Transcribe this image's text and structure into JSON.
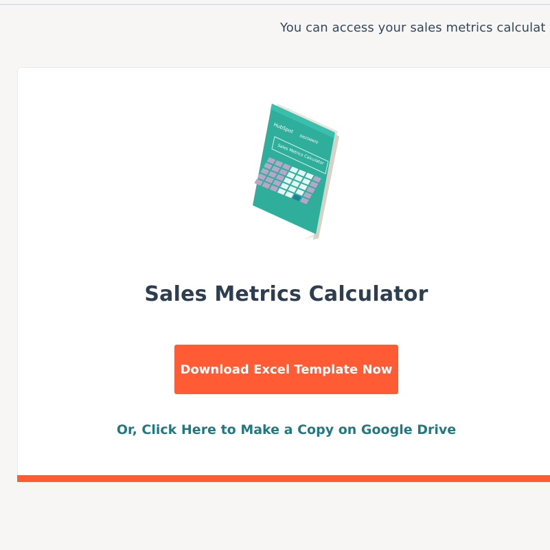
{
  "intro_text": "You can access your sales metrics calculat",
  "card": {
    "title": "Sales Metrics Calculator",
    "download_button_label": "Download Excel Template Now",
    "google_drive_link": "Or, Click Here to Make a Copy on Google Drive"
  },
  "book_cover": {
    "brand_left": "HubSpot",
    "brand_right": "DIGITAPATE",
    "cover_title": "Sales Metrics Calculator"
  },
  "colors": {
    "accent": "#ff5c35",
    "link": "#1f7a7f",
    "heading": "#2d3e50",
    "book_teal": "#2fae9c"
  },
  "icons": [
    "calculator-book-icon"
  ]
}
